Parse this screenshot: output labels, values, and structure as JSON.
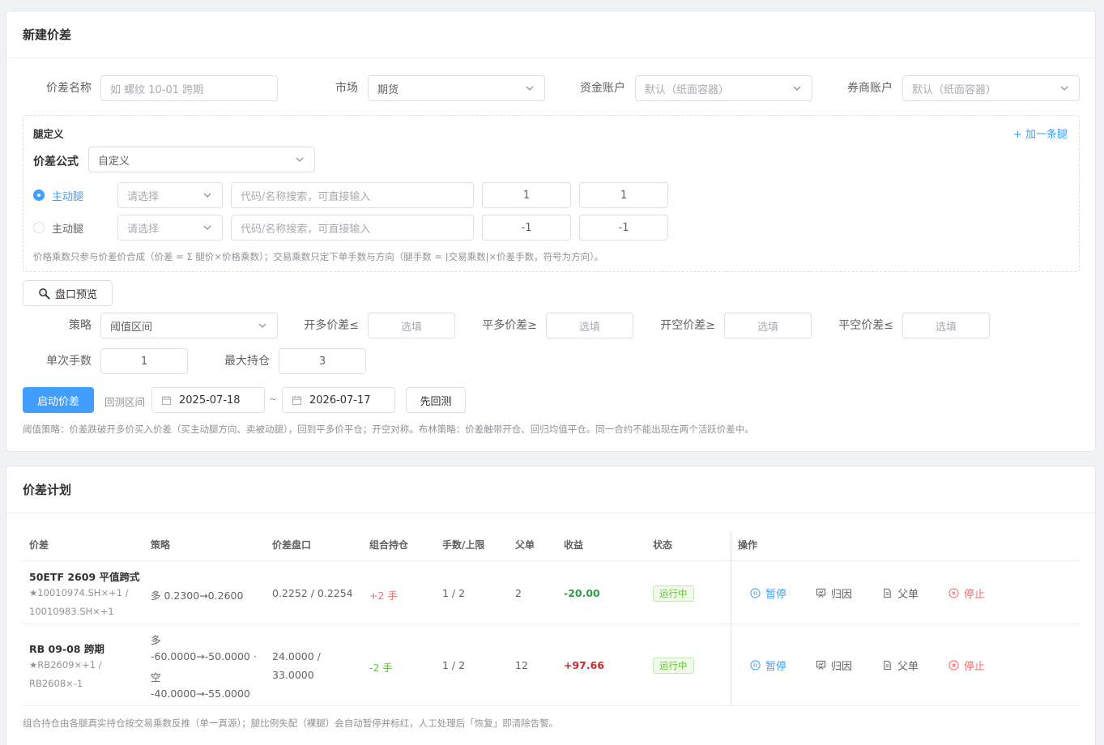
{
  "create": {
    "title": "新建价差",
    "name_label": "价差名称",
    "name_placeholder": "如 螺纹 10-01 跨期",
    "market_label": "市场",
    "market_value": "期货",
    "fund_label": "资金账户",
    "fund_value": "默认（纸面容器）",
    "broker_label": "券商账户",
    "broker_value": "默认（纸面容器）",
    "legs": {
      "title": "腿定义",
      "add_leg": "+ 加一条腿",
      "formula_label": "价差公式",
      "formula_value": "自定义",
      "rows": [
        {
          "role": "主动腿",
          "type_placeholder": "请选择",
          "code_placeholder": "代码/名称搜索，可直接输入",
          "price_mult": "1",
          "trade_mult": "1",
          "selected": true
        },
        {
          "role": "主动腿",
          "type_placeholder": "请选择",
          "code_placeholder": "代码/名称搜索，可直接输入",
          "price_mult": "-1",
          "trade_mult": "-1",
          "selected": false
        }
      ],
      "hint": "价格乘数只参与价差价合成（价差 = Σ 腿价×价格乘数）；交易乘数只定下单手数与方向（腿手数 = |交易乘数|×价差手数，符号为方向）。"
    },
    "preview_button": "盘口预览",
    "strategy_label": "策略",
    "strategy_value": "阈值区间",
    "open_long_label": "开多价差≤",
    "close_long_label": "平多价差≥",
    "open_short_label": "开空价差≥",
    "close_short_label": "平空价差≤",
    "optional_placeholder": "选填",
    "lot_label": "单次手数",
    "lot_value": "1",
    "max_pos_label": "最大持仓",
    "max_pos_value": "3",
    "start_button": "启动价差",
    "backtest_label": "回测区间",
    "date_start": "2025-07-18",
    "date_sep": "~",
    "date_end": "2026-07-17",
    "backtest_button": "先回测",
    "strategy_hint": "阈值策略：价差跌破开多价买入价差（买主动腿方向、卖被动腿），回到平多价平仓；开空对称。布林策略：价差触带开仓、回归均值平仓。同一合约不能出现在两个活跃价差中。"
  },
  "plans": {
    "title": "价差计划",
    "columns": [
      "价差",
      "策略",
      "价差盘口",
      "组合持仓",
      "手数/上限",
      "父单",
      "收益",
      "状态",
      "操作"
    ],
    "rows": [
      {
        "name": "50ETF 2609 平值跨式",
        "legs1": "★10010974.SH×+1 /",
        "legs2": "10010983.SH×+1",
        "strategy": "多 0.2300→0.2600",
        "quote": "0.2252 / 0.2254",
        "position": "+2 手",
        "lots": "1 / 2",
        "parents": "2",
        "pnl": "-20.00",
        "status": "运行中"
      },
      {
        "name": "RB 09-08 跨期",
        "legs1": "★RB2609×+1 /",
        "legs2": "RB2608×-1",
        "strategy1": "多",
        "strategy2": "-60.0000→-50.0000 ·",
        "strategy3": "空",
        "strategy4": "-40.0000→-55.0000",
        "quote1": "24.0000 /",
        "quote2": "33.0000",
        "position": "-2 手",
        "lots": "1 / 2",
        "parents": "12",
        "pnl": "+97.66",
        "status": "运行中"
      }
    ],
    "ops": {
      "pause": "暂停",
      "attribution": "归因",
      "parent": "父单",
      "stop": "停止"
    },
    "footer_hint": "组合持仓由各腿真实持仓按交易乘数反推（单一真源）；腿比例失配（裸腿）会自动暂停并标红，人工处理后「恢复」即清除告警。"
  },
  "colors": {
    "primary": "#409eff",
    "success": "#67c23a",
    "danger": "#f56c6c"
  }
}
